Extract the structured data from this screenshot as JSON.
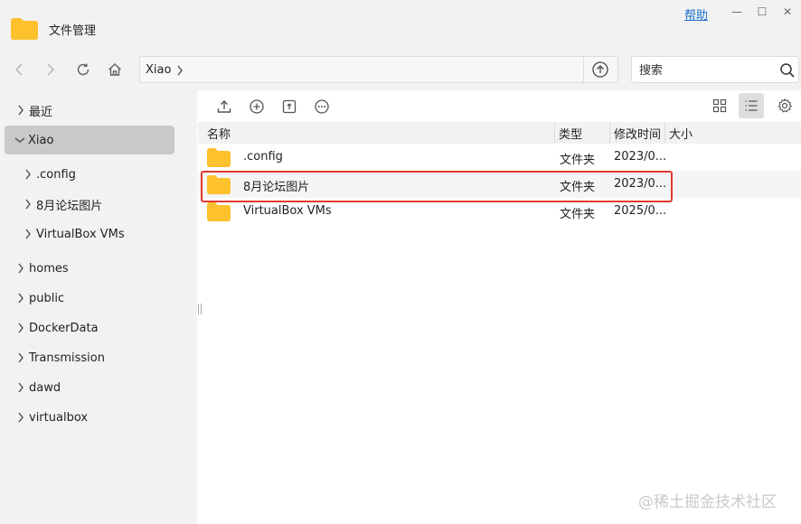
{
  "window": {
    "title": "文件管理",
    "help_label": "帮助",
    "minimize_glyph": "—",
    "maximize_glyph": "☐",
    "close_glyph": "✕",
    "folder_color": "#fcc12d"
  },
  "navbar": {
    "breadcrumb": [
      "Xiao"
    ],
    "search_placeholder": "搜索"
  },
  "sidebar": {
    "items": [
      {
        "label": "最近",
        "expanded": false
      },
      {
        "label": "Xiao",
        "expanded": true,
        "active": true
      },
      {
        "label": ".config",
        "child": true
      },
      {
        "label": "8月论坛图片",
        "child": true
      },
      {
        "label": "VirtualBox VMs",
        "child": true
      },
      {
        "label": "homes"
      },
      {
        "label": "public"
      },
      {
        "label": "DockerData"
      },
      {
        "label": "Transmission"
      },
      {
        "label": "dawd"
      },
      {
        "label": "virtualbox"
      }
    ]
  },
  "toolbar": {
    "icons": [
      "upload-icon",
      "new-folder-icon",
      "share-icon",
      "more-icon"
    ],
    "view_icons": [
      "grid-view-icon",
      "list-view-icon",
      "settings-icon"
    ]
  },
  "table": {
    "columns": [
      "名称",
      "类型",
      "修改时间",
      "大小"
    ],
    "rows": [
      {
        "name": ".config",
        "type": "文件夹",
        "modified": "2023/0...",
        "size": ""
      },
      {
        "name": "8月论坛图片",
        "type": "文件夹",
        "modified": "2023/0...",
        "size": "",
        "highlighted": true
      },
      {
        "name": "VirtualBox VMs",
        "type": "文件夹",
        "modified": "2025/0...",
        "size": ""
      }
    ]
  },
  "watermark": "@稀土掘金技术社区"
}
